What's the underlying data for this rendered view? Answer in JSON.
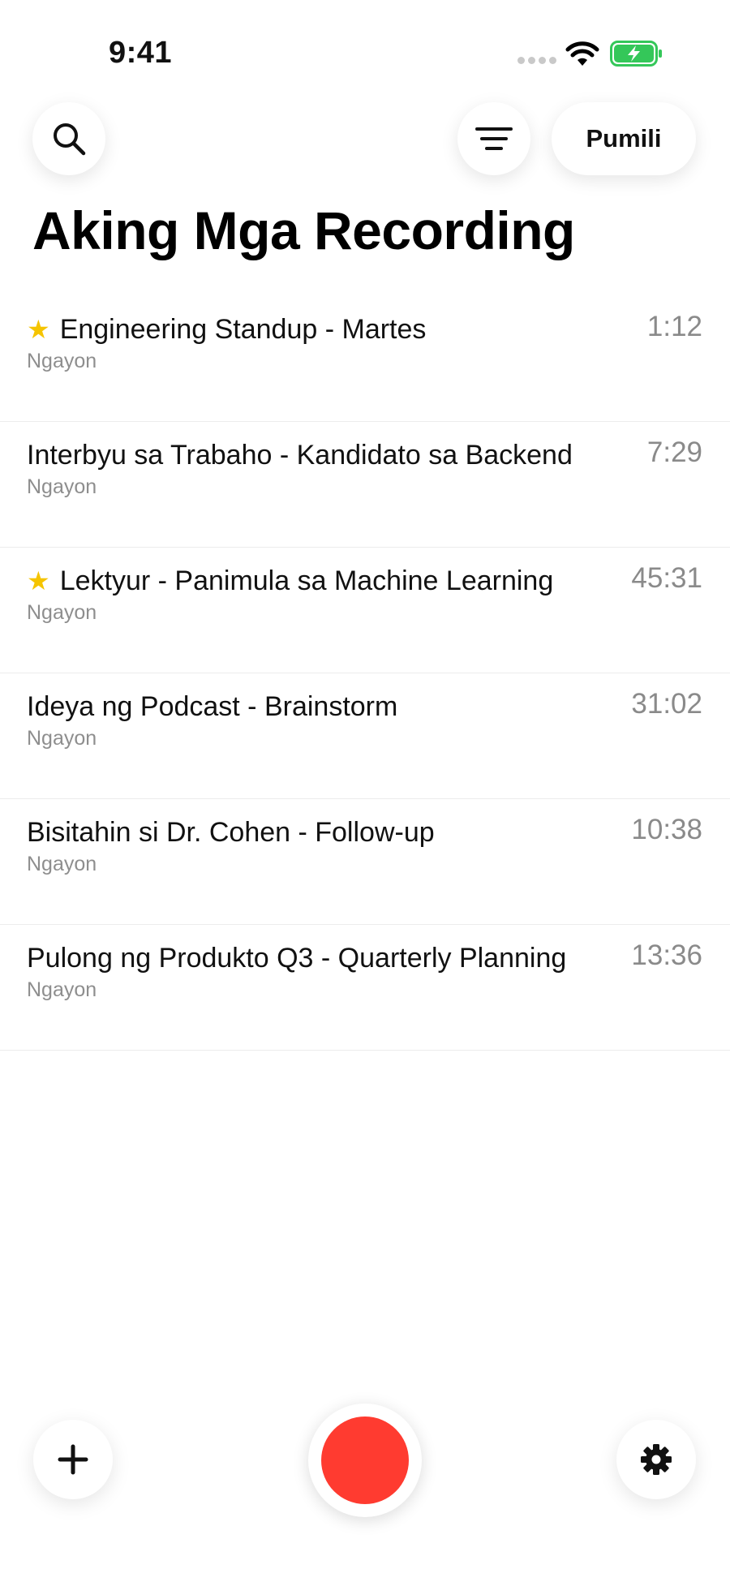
{
  "status_bar": {
    "time": "9:41"
  },
  "header": {
    "select_label": "Pumili",
    "title": "Aking Mga Recording"
  },
  "icons": {
    "search": "search-icon",
    "filter": "filter-icon",
    "add": "plus-icon",
    "settings": "gear-icon",
    "star": "star-icon"
  },
  "colors": {
    "record": "#ff3b30",
    "star": "#f5c400",
    "battery": "#34c759"
  },
  "recordings": [
    {
      "title": "Engineering Standup - Martes",
      "date": "Ngayon",
      "duration": "1:12",
      "starred": true,
      "star_glyph": "★"
    },
    {
      "title": "Interbyu sa Trabaho - Kandidato sa Backend",
      "date": "Ngayon",
      "duration": "7:29",
      "starred": false,
      "star_glyph": ""
    },
    {
      "title": "Lektyur - Panimula sa Machine Learning",
      "date": "Ngayon",
      "duration": "45:31",
      "starred": true,
      "star_glyph": "★"
    },
    {
      "title": "Ideya ng Podcast - Brainstorm",
      "date": "Ngayon",
      "duration": "31:02",
      "starred": false,
      "star_glyph": ""
    },
    {
      "title": "Bisitahin si Dr. Cohen - Follow-up",
      "date": "Ngayon",
      "duration": "10:38",
      "starred": false,
      "star_glyph": ""
    },
    {
      "title": "Pulong ng Produkto Q3 - Quarterly Planning",
      "date": "Ngayon",
      "duration": "13:36",
      "starred": false,
      "star_glyph": ""
    }
  ]
}
